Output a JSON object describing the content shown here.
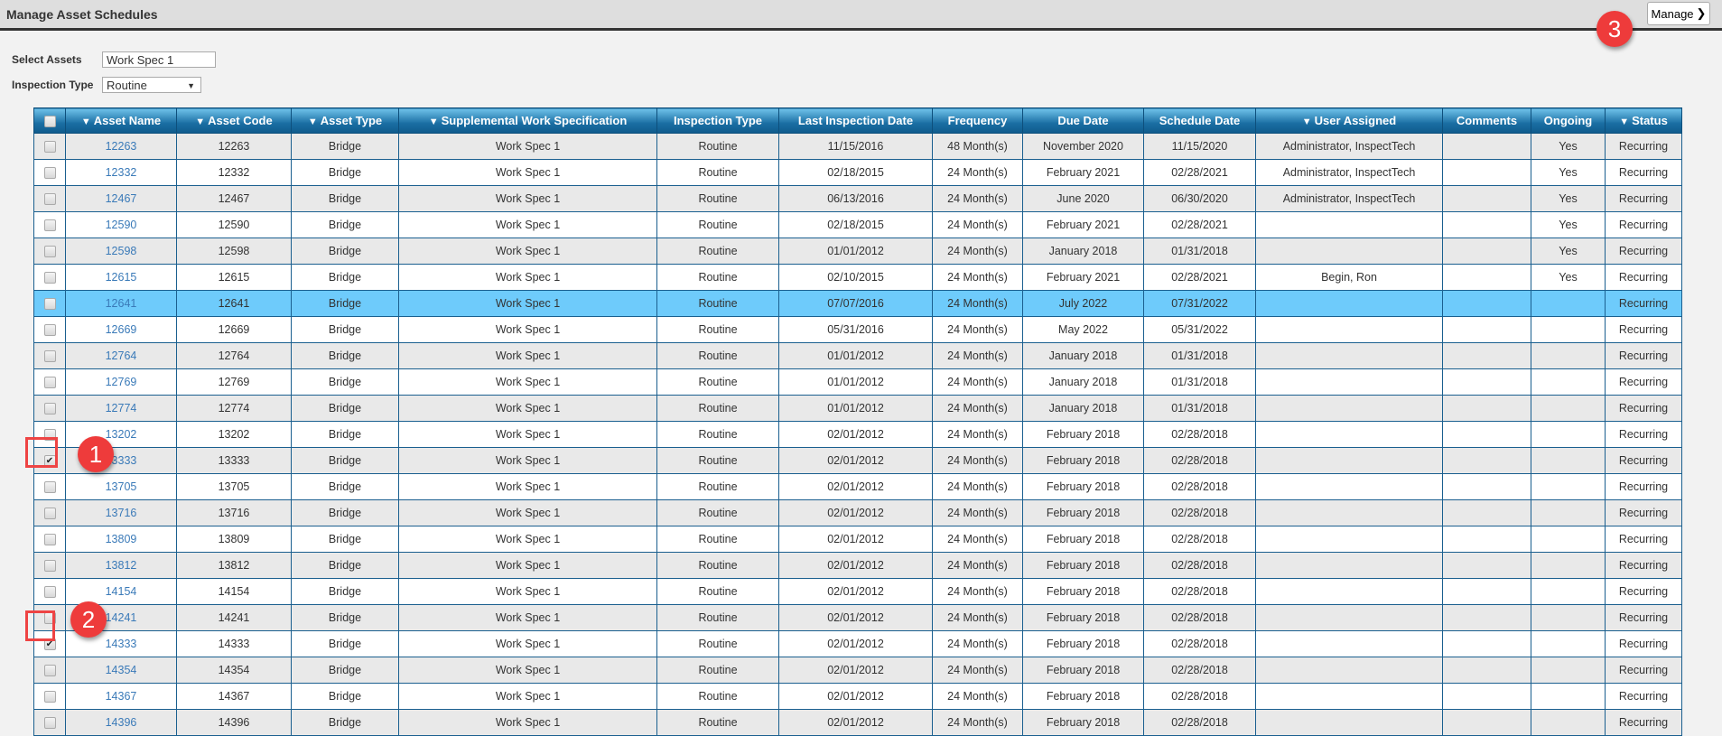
{
  "header": {
    "title": "Manage Asset Schedules",
    "manage_label": "Manage",
    "manage_icon": "chevron-down-icon"
  },
  "filters": {
    "select_assets_label": "Select Assets",
    "select_assets_value": "Work Spec 1",
    "inspection_type_label": "Inspection Type",
    "inspection_type_value": "Routine"
  },
  "annotations": [
    "1",
    "2",
    "3"
  ],
  "columns": [
    "",
    "Asset Name",
    "Asset Code",
    "Asset Type",
    "Supplemental Work Specification",
    "Inspection Type",
    "Last Inspection Date",
    "Frequency",
    "Due Date",
    "Schedule Date",
    "User Assigned",
    "Comments",
    "Ongoing",
    "Status"
  ],
  "filterable_columns": [
    1,
    2,
    3,
    4,
    10,
    13
  ],
  "rows": [
    {
      "checked": false,
      "selected": false,
      "cells": [
        "12263",
        "12263",
        "Bridge",
        "Work Spec 1",
        "Routine",
        "11/15/2016",
        "48 Month(s)",
        "November 2020",
        "11/15/2020",
        "Administrator, InspectTech",
        "",
        "Yes",
        "Recurring"
      ]
    },
    {
      "checked": false,
      "selected": false,
      "cells": [
        "12332",
        "12332",
        "Bridge",
        "Work Spec 1",
        "Routine",
        "02/18/2015",
        "24 Month(s)",
        "February 2021",
        "02/28/2021",
        "Administrator, InspectTech",
        "",
        "Yes",
        "Recurring"
      ]
    },
    {
      "checked": false,
      "selected": false,
      "cells": [
        "12467",
        "12467",
        "Bridge",
        "Work Spec 1",
        "Routine",
        "06/13/2016",
        "24 Month(s)",
        "June 2020",
        "06/30/2020",
        "Administrator, InspectTech",
        "",
        "Yes",
        "Recurring"
      ]
    },
    {
      "checked": false,
      "selected": false,
      "cells": [
        "12590",
        "12590",
        "Bridge",
        "Work Spec 1",
        "Routine",
        "02/18/2015",
        "24 Month(s)",
        "February 2021",
        "02/28/2021",
        "",
        "",
        "Yes",
        "Recurring"
      ]
    },
    {
      "checked": false,
      "selected": false,
      "cells": [
        "12598",
        "12598",
        "Bridge",
        "Work Spec 1",
        "Routine",
        "01/01/2012",
        "24 Month(s)",
        "January 2018",
        "01/31/2018",
        "",
        "",
        "Yes",
        "Recurring"
      ]
    },
    {
      "checked": false,
      "selected": false,
      "cells": [
        "12615",
        "12615",
        "Bridge",
        "Work Spec 1",
        "Routine",
        "02/10/2015",
        "24 Month(s)",
        "February 2021",
        "02/28/2021",
        "Begin, Ron",
        "",
        "Yes",
        "Recurring"
      ]
    },
    {
      "checked": false,
      "selected": true,
      "cells": [
        "12641",
        "12641",
        "Bridge",
        "Work Spec 1",
        "Routine",
        "07/07/2016",
        "24 Month(s)",
        "July 2022",
        "07/31/2022",
        "",
        "",
        "",
        "Recurring"
      ]
    },
    {
      "checked": false,
      "selected": false,
      "cells": [
        "12669",
        "12669",
        "Bridge",
        "Work Spec 1",
        "Routine",
        "05/31/2016",
        "24 Month(s)",
        "May 2022",
        "05/31/2022",
        "",
        "",
        "",
        "Recurring"
      ]
    },
    {
      "checked": false,
      "selected": false,
      "cells": [
        "12764",
        "12764",
        "Bridge",
        "Work Spec 1",
        "Routine",
        "01/01/2012",
        "24 Month(s)",
        "January 2018",
        "01/31/2018",
        "",
        "",
        "",
        "Recurring"
      ]
    },
    {
      "checked": false,
      "selected": false,
      "cells": [
        "12769",
        "12769",
        "Bridge",
        "Work Spec 1",
        "Routine",
        "01/01/2012",
        "24 Month(s)",
        "January 2018",
        "01/31/2018",
        "",
        "",
        "",
        "Recurring"
      ]
    },
    {
      "checked": false,
      "selected": false,
      "cells": [
        "12774",
        "12774",
        "Bridge",
        "Work Spec 1",
        "Routine",
        "01/01/2012",
        "24 Month(s)",
        "January 2018",
        "01/31/2018",
        "",
        "",
        "",
        "Recurring"
      ]
    },
    {
      "checked": false,
      "selected": false,
      "cells": [
        "13202",
        "13202",
        "Bridge",
        "Work Spec 1",
        "Routine",
        "02/01/2012",
        "24 Month(s)",
        "February 2018",
        "02/28/2018",
        "",
        "",
        "",
        "Recurring"
      ]
    },
    {
      "checked": true,
      "selected": false,
      "cells": [
        "13333",
        "13333",
        "Bridge",
        "Work Spec 1",
        "Routine",
        "02/01/2012",
        "24 Month(s)",
        "February 2018",
        "02/28/2018",
        "",
        "",
        "",
        "Recurring"
      ]
    },
    {
      "checked": false,
      "selected": false,
      "cells": [
        "13705",
        "13705",
        "Bridge",
        "Work Spec 1",
        "Routine",
        "02/01/2012",
        "24 Month(s)",
        "February 2018",
        "02/28/2018",
        "",
        "",
        "",
        "Recurring"
      ]
    },
    {
      "checked": false,
      "selected": false,
      "cells": [
        "13716",
        "13716",
        "Bridge",
        "Work Spec 1",
        "Routine",
        "02/01/2012",
        "24 Month(s)",
        "February 2018",
        "02/28/2018",
        "",
        "",
        "",
        "Recurring"
      ]
    },
    {
      "checked": false,
      "selected": false,
      "cells": [
        "13809",
        "13809",
        "Bridge",
        "Work Spec 1",
        "Routine",
        "02/01/2012",
        "24 Month(s)",
        "February 2018",
        "02/28/2018",
        "",
        "",
        "",
        "Recurring"
      ]
    },
    {
      "checked": false,
      "selected": false,
      "cells": [
        "13812",
        "13812",
        "Bridge",
        "Work Spec 1",
        "Routine",
        "02/01/2012",
        "24 Month(s)",
        "February 2018",
        "02/28/2018",
        "",
        "",
        "",
        "Recurring"
      ]
    },
    {
      "checked": false,
      "selected": false,
      "cells": [
        "14154",
        "14154",
        "Bridge",
        "Work Spec 1",
        "Routine",
        "02/01/2012",
        "24 Month(s)",
        "February 2018",
        "02/28/2018",
        "",
        "",
        "",
        "Recurring"
      ]
    },
    {
      "checked": false,
      "selected": false,
      "cells": [
        "14241",
        "14241",
        "Bridge",
        "Work Spec 1",
        "Routine",
        "02/01/2012",
        "24 Month(s)",
        "February 2018",
        "02/28/2018",
        "",
        "",
        "",
        "Recurring"
      ]
    },
    {
      "checked": true,
      "selected": false,
      "cells": [
        "14333",
        "14333",
        "Bridge",
        "Work Spec 1",
        "Routine",
        "02/01/2012",
        "24 Month(s)",
        "February 2018",
        "02/28/2018",
        "",
        "",
        "",
        "Recurring"
      ]
    },
    {
      "checked": false,
      "selected": false,
      "cells": [
        "14354",
        "14354",
        "Bridge",
        "Work Spec 1",
        "Routine",
        "02/01/2012",
        "24 Month(s)",
        "February 2018",
        "02/28/2018",
        "",
        "",
        "",
        "Recurring"
      ]
    },
    {
      "checked": false,
      "selected": false,
      "cells": [
        "14367",
        "14367",
        "Bridge",
        "Work Spec 1",
        "Routine",
        "02/01/2012",
        "24 Month(s)",
        "February 2018",
        "02/28/2018",
        "",
        "",
        "",
        "Recurring"
      ]
    },
    {
      "checked": false,
      "selected": false,
      "cells": [
        "14396",
        "14396",
        "Bridge",
        "Work Spec 1",
        "Routine",
        "02/01/2012",
        "24 Month(s)",
        "February 2018",
        "02/28/2018",
        "",
        "",
        "",
        "Recurring"
      ]
    }
  ]
}
